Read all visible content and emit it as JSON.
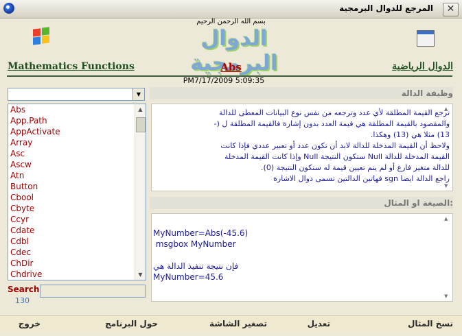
{
  "window": {
    "title": "المرجع للدوال البرمجية",
    "close_symbol": "✕"
  },
  "header": {
    "basmala": "بسم الله الرحمن الرحيم",
    "logo_text": "الدوال البرمجية",
    "left_link": "Mathematics Functions",
    "right_link": "الدوال الرياضية",
    "function_name": "Abs",
    "timestamp": "PM7/17/2009 5:09:35"
  },
  "icons": {
    "left": "windows-logo-icon",
    "right": "document-window-icon"
  },
  "function_list": {
    "items": [
      "Abs",
      "App.Path",
      "AppActivate",
      "Array",
      "Asc",
      "Ascw",
      "Atn",
      "Button",
      "Cbool",
      "Cbyte",
      "Ccyr",
      "Cdate",
      "Cdbl",
      "Cdec",
      "ChDir",
      "Chdrive"
    ],
    "search_label": "Search",
    "count": "130"
  },
  "description": {
    "header": "وظيفة الدالة",
    "lines": [
      "ترجع القيمة المطلقة لأي عدد وترجعه من نفس نوع البيانات المعطى للدالة",
      "والمقصود بالقيمة المطلقة هي قيمة العدد بدون إشارة فالقيمة المطلقة ل (-",
      "13) مثلا هي (13) وهكذا.",
      "ولاحظ أن القيمة المدخلة للدالة لابد أن تكون عدد أو تعبير عددي فإذا كانت",
      "القيمة المدخلة للدالة Null ستكون النتيجة Null وإذا كانت القيمة المدخلة",
      "للدالة متغير فارغ أو لم يتم تعيين قيمة له ستكون النتيجة (0).",
      "راجع الدالة  ايضا sgn فهاتين الدالتين تسمى دوال الاشارة"
    ]
  },
  "syntax": {
    "header": "الصيغة او المثال:",
    "lines": [
      "MyNumber=Abs(-45.6)",
      " msgbox MyNumber",
      "",
      "فإن نتيجة تنفيذ الدالة هي",
      "MyNumber=45.6"
    ]
  },
  "bottom_menu": {
    "copy_example": "نسخ  المثال",
    "edit": "تعديل",
    "minimize": "تصغير الشاشة",
    "about": "حول البرنامج",
    "exit": "خروج"
  },
  "colors": {
    "accent": "#a00000",
    "text_blue": "#1a1a9a",
    "header_green": "#1f4f1f"
  }
}
